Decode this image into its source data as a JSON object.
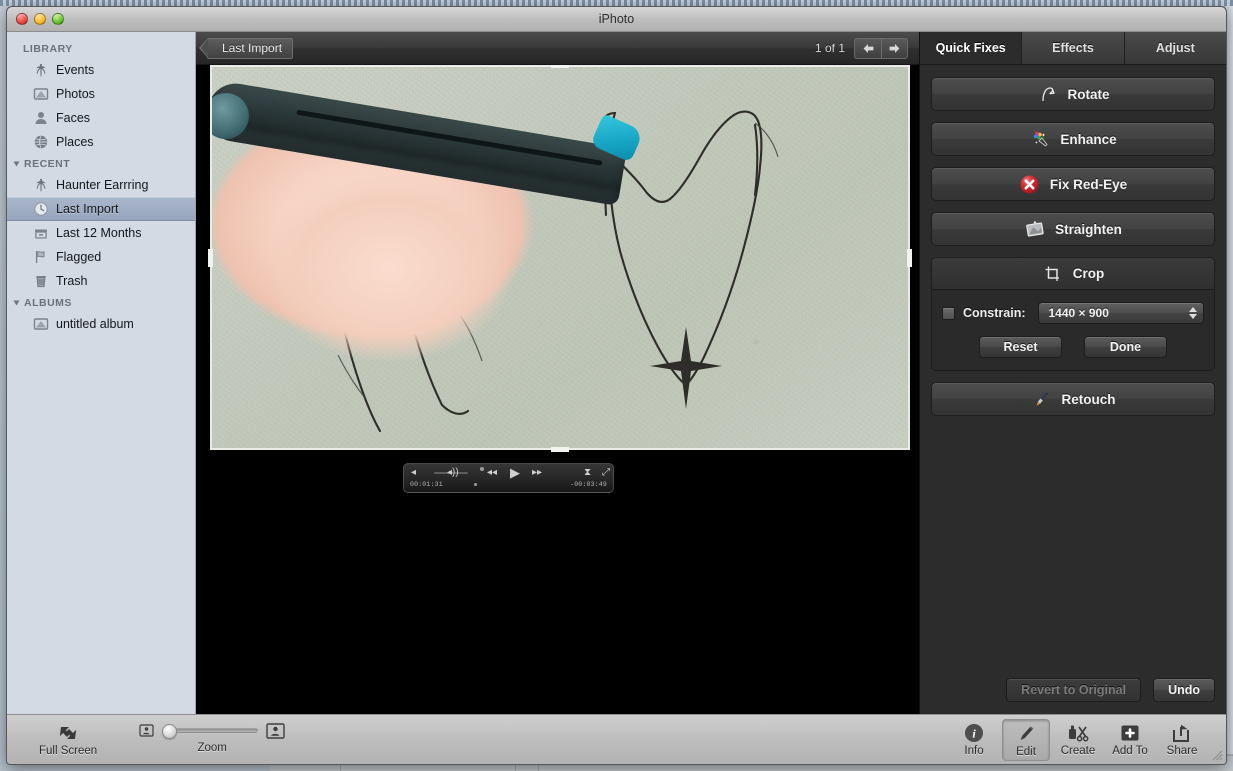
{
  "window": {
    "title": "iPhoto",
    "traffic_lights": [
      "close-button",
      "minimize-button",
      "zoom-button"
    ]
  },
  "sidebar": {
    "sections": [
      {
        "header": "LIBRARY",
        "collapsible": false,
        "items": [
          {
            "label": "Events",
            "icon": "palm-tree-icon",
            "selected": false
          },
          {
            "label": "Photos",
            "icon": "photo-frame-icon",
            "selected": false
          },
          {
            "label": "Faces",
            "icon": "person-icon",
            "selected": false
          },
          {
            "label": "Places",
            "icon": "globe-icon",
            "selected": false
          }
        ]
      },
      {
        "header": "RECENT",
        "collapsible": true,
        "items": [
          {
            "label": "Haunter Earrring",
            "icon": "palm-tree-icon",
            "selected": false
          },
          {
            "label": "Last Import",
            "icon": "clock-icon",
            "selected": true
          },
          {
            "label": "Last 12 Months",
            "icon": "archive-box-icon",
            "selected": false
          },
          {
            "label": "Flagged",
            "icon": "flag-icon",
            "selected": false
          },
          {
            "label": "Trash",
            "icon": "trash-icon",
            "selected": false
          }
        ]
      },
      {
        "header": "ALBUMS",
        "collapsible": true,
        "items": [
          {
            "label": "untitled album",
            "icon": "photo-frame-icon",
            "selected": false
          }
        ]
      }
    ]
  },
  "topbar": {
    "breadcrumb": "Last Import",
    "counter": "1 of 1",
    "prev_icon": "arrow-left-icon",
    "next_icon": "arrow-right-icon"
  },
  "video_controls": {
    "current_time": "00:01:31",
    "remaining_time": "-00:03:49",
    "buttons": [
      "volume-low-icon",
      "volume-high-icon",
      "rewind-icon",
      "play-icon",
      "fast-forward-icon",
      "trim-icon",
      "fullscreen-icon"
    ]
  },
  "panel": {
    "tabs": [
      {
        "label": "Quick Fixes",
        "active": true
      },
      {
        "label": "Effects",
        "active": false
      },
      {
        "label": "Adjust",
        "active": false
      }
    ],
    "quick_fixes": [
      {
        "label": "Rotate",
        "icon": "rotate-icon"
      },
      {
        "label": "Enhance",
        "icon": "magic-wand-icon"
      },
      {
        "label": "Fix Red-Eye",
        "icon": "red-eye-icon"
      },
      {
        "label": "Straighten",
        "icon": "straighten-icon"
      }
    ],
    "crop": {
      "title": "Crop",
      "icon": "crop-icon",
      "constrain_label": "Constrain:",
      "constrain_checked": false,
      "constrain_value": "1440 × 900",
      "reset_label": "Reset",
      "done_label": "Done"
    },
    "retouch": {
      "label": "Retouch",
      "icon": "brush-icon"
    },
    "footer": {
      "revert_label": "Revert to Original",
      "revert_enabled": false,
      "undo_label": "Undo",
      "undo_enabled": true
    }
  },
  "toolbar": {
    "full_screen_label": "Full Screen",
    "full_screen_icon": "full-screen-icon",
    "zoom_label": "Zoom",
    "zoom_min_icon": "zoom-small-icon",
    "zoom_max_icon": "zoom-large-icon",
    "zoom_value": 0,
    "right_items": [
      {
        "label": "Info",
        "icon": "info-icon",
        "active": false
      },
      {
        "label": "Edit",
        "icon": "pencil-icon",
        "active": true
      },
      {
        "label": "Create",
        "icon": "scissors-icon",
        "active": false
      },
      {
        "label": "Add To",
        "icon": "plus-icon",
        "active": false
      },
      {
        "label": "Share",
        "icon": "share-icon",
        "active": false
      }
    ]
  },
  "colors": {
    "panel_bg": "#2c2c2c",
    "sidebar_bg": "#d3dae3",
    "selection": "#a0aec4",
    "accent_red": "#c9232c",
    "pen_teal": "#16a4c4"
  }
}
